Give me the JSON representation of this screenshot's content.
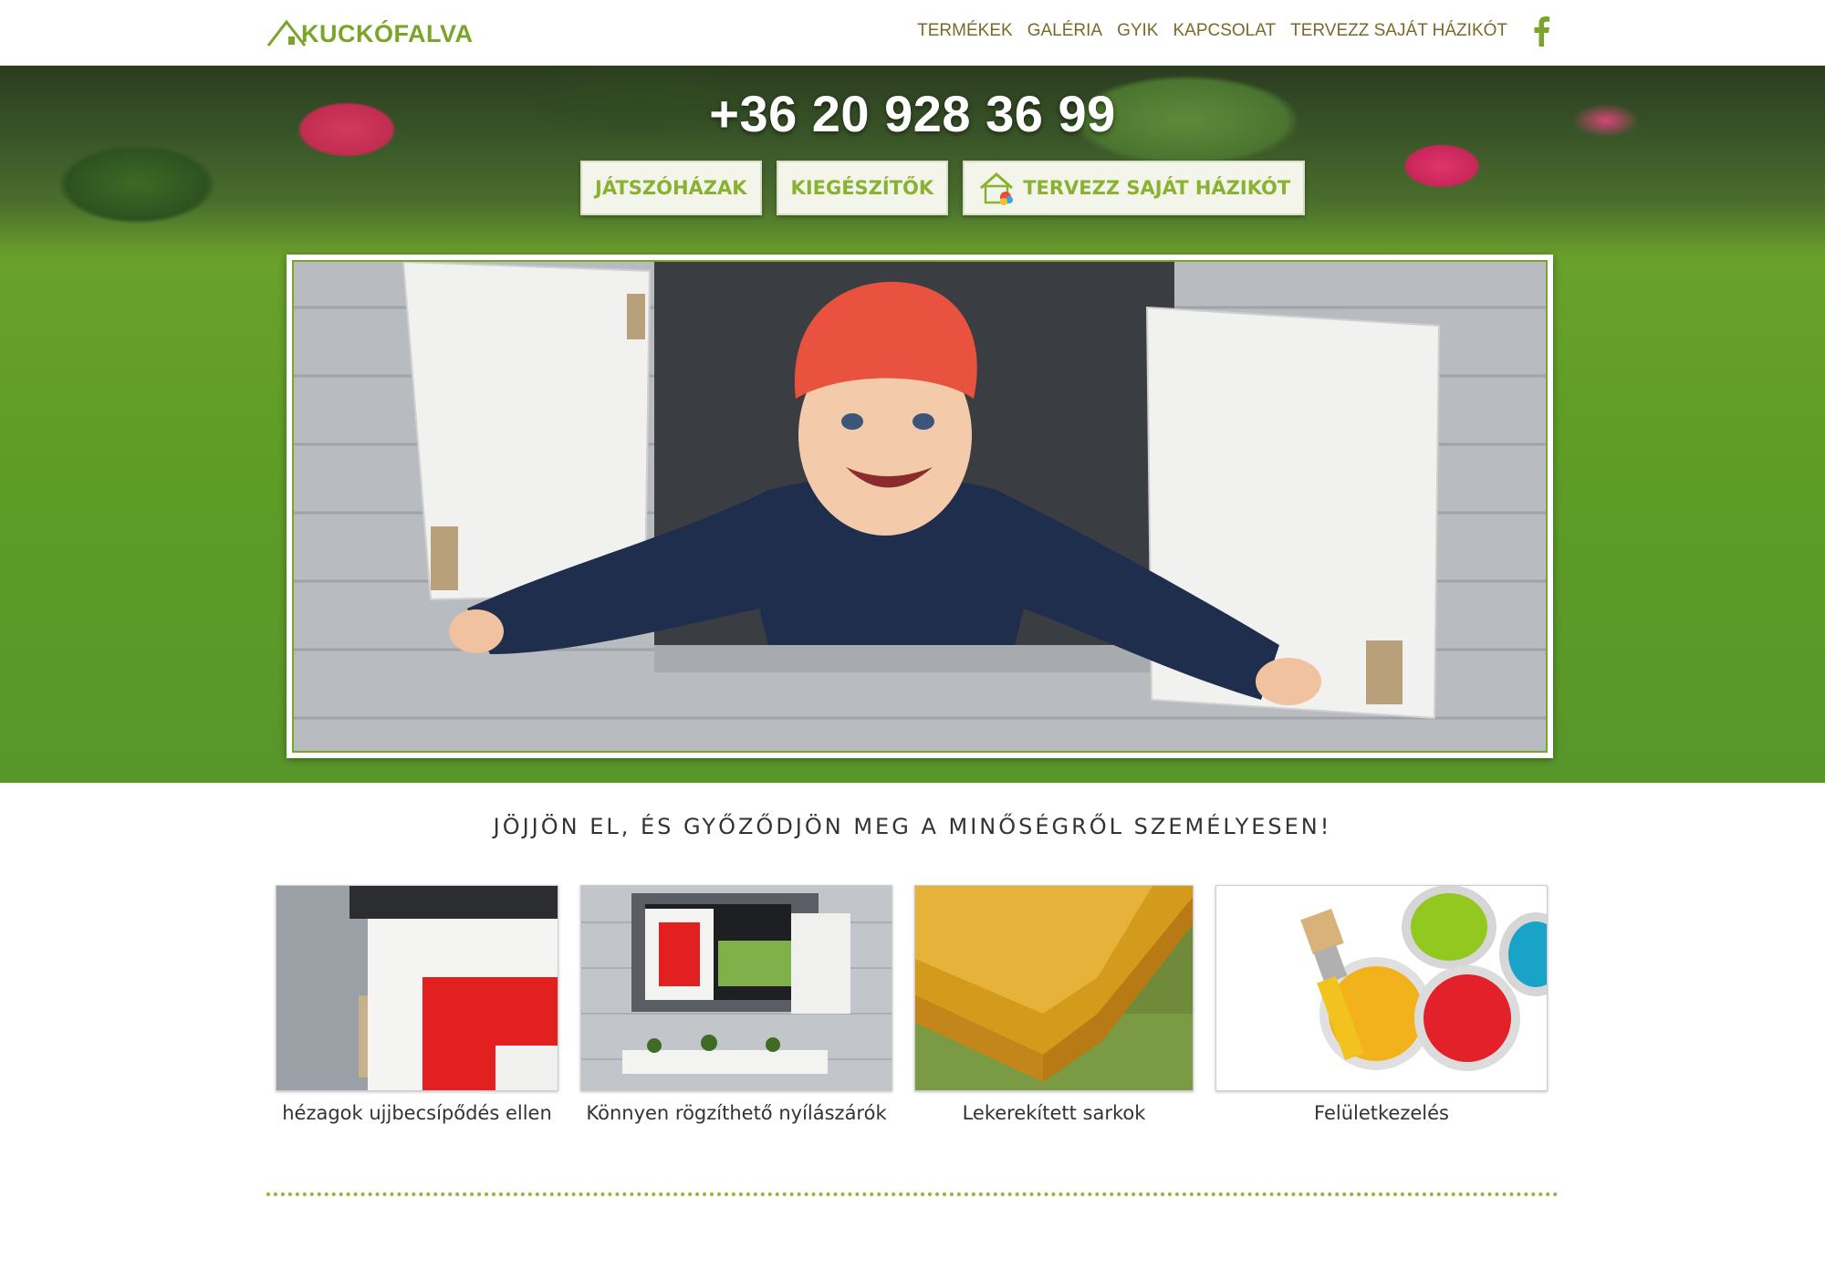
{
  "brand": {
    "logo_text": "KUCKÓFALVA",
    "accent_color": "#7aa52a"
  },
  "nav": {
    "items": [
      "TERMÉKEK",
      "GALÉRIA",
      "GYIK",
      "KAPCSOLAT",
      "TERVEZZ SAJÁT HÁZIKÓT"
    ],
    "social_icon": "facebook-icon"
  },
  "hero": {
    "phone": "+36 20 928 36 99",
    "buttons": [
      "JÁTSZÓHÁZAK",
      "KIEGÉSZÍTŐK",
      "TERVEZZ SAJÁT HÁZIKÓT"
    ],
    "design_button_icon": "house-color-icon"
  },
  "section": {
    "tagline": "JÖJJÖN EL, ÉS GYŐZŐDJÖN MEG A MINŐSÉGRŐL SZEMÉLYESEN!",
    "features": [
      {
        "caption": "hézagok ujjbecsípődés ellen"
      },
      {
        "caption": "Könnyen rögzíthető nyílászárók"
      },
      {
        "caption": "Lekerekített sarkok"
      },
      {
        "caption": "Felületkezelés"
      }
    ]
  }
}
